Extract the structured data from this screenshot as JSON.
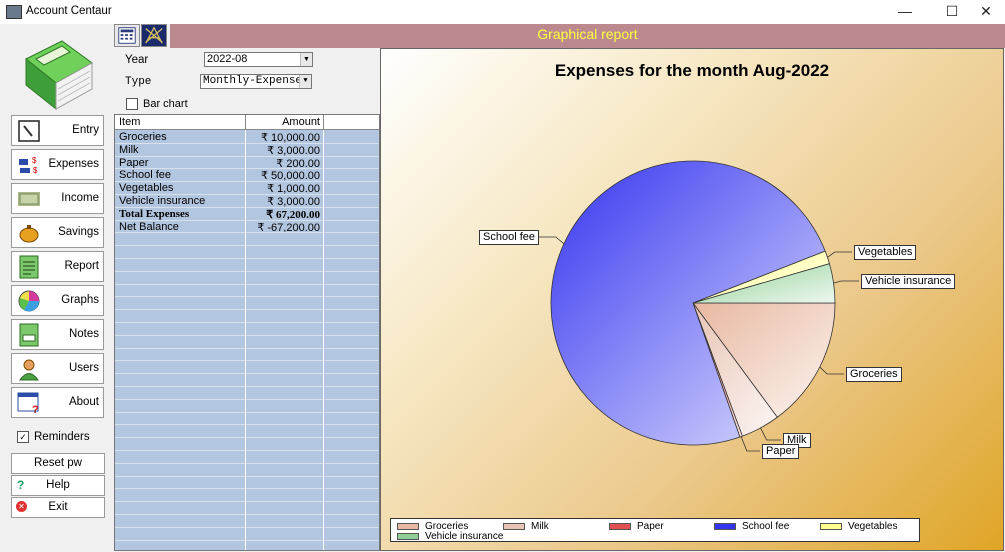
{
  "window": {
    "title": "Account Centaur",
    "minimize": "—",
    "maximize": "☐",
    "close": "✕"
  },
  "sidebar": {
    "items": [
      {
        "label": "Entry"
      },
      {
        "label": "Expenses"
      },
      {
        "label": "Income"
      },
      {
        "label": "Savings"
      },
      {
        "label": "Report"
      },
      {
        "label": "Graphs"
      },
      {
        "label": "Notes"
      },
      {
        "label": "Users"
      },
      {
        "label": "About"
      }
    ],
    "reminders_label": "Reminders",
    "reminders_checked": "✓",
    "reset_label": "Reset pw",
    "help_label": "Help",
    "exit_label": "Exit"
  },
  "header": {
    "title": "Graphical report"
  },
  "filters": {
    "year_label": "Year",
    "year_value": "2022-08",
    "type_label": "Type",
    "type_value": "Monthly-Expenses",
    "barchart_label": "Bar chart"
  },
  "table": {
    "headers": [
      "Item",
      "Amount"
    ],
    "rows": [
      {
        "item": "Groceries",
        "amount": "₹ 10,000.00"
      },
      {
        "item": "Milk",
        "amount": "₹ 3,000.00"
      },
      {
        "item": "Paper",
        "amount": "₹ 200.00"
      },
      {
        "item": "School fee",
        "amount": "₹ 50,000.00"
      },
      {
        "item": "Vegetables",
        "amount": "₹ 1,000.00"
      },
      {
        "item": "Vehicle insurance",
        "amount": "₹ 3,000.00"
      },
      {
        "item": "Total Expenses",
        "amount": "₹ 67,200.00"
      },
      {
        "item": "Net Balance",
        "amount": "₹ -67,200.00"
      }
    ]
  },
  "colors": {
    "header_band": "#bc8a8e",
    "header_text": "#ffff40",
    "grid_bg": "#b3c6df"
  },
  "chart_data": {
    "type": "pie",
    "title": "Expenses for the month Aug-2022",
    "categories": [
      "Groceries",
      "Milk",
      "Paper",
      "School fee",
      "Vegetables",
      "Vehicle insurance"
    ],
    "values": [
      10000,
      3000,
      200,
      50000,
      1000,
      3000
    ],
    "colors": [
      "#e8b8a0",
      "#e8c4b4",
      "#e05050",
      "#3434f0",
      "#ffff90",
      "#8fcf97"
    ],
    "legend_position": "bottom"
  }
}
